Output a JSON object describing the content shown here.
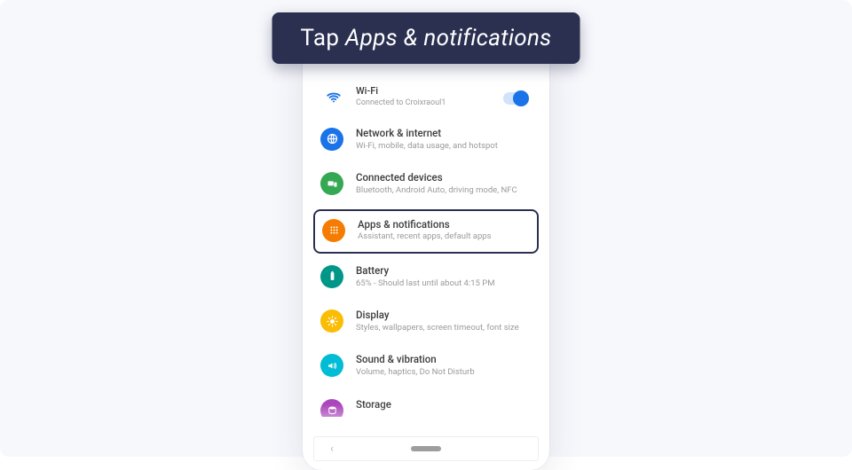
{
  "banner": {
    "prefix": "Tap ",
    "italic": "Apps & notifications"
  },
  "settings": {
    "wifi": {
      "title": "Wi-Fi",
      "subtitle": "Connected to Croixraoul1",
      "icon_color": "#1a73e8"
    },
    "items": [
      {
        "title": "Network & internet",
        "subtitle": "Wi-Fi, mobile, data usage, and hotspot",
        "icon_color": "#1a73e8",
        "icon": "globe",
        "highlighted": false
      },
      {
        "title": "Connected devices",
        "subtitle": "Bluetooth, Android Auto, driving mode, NFC",
        "icon_color": "#34a853",
        "icon": "devices",
        "highlighted": false
      },
      {
        "title": "Apps & notifications",
        "subtitle": "Assistant, recent apps, default apps",
        "icon_color": "#f57c00",
        "icon": "grid",
        "highlighted": true
      },
      {
        "title": "Battery",
        "subtitle": "65% - Should last until about 4:15 PM",
        "icon_color": "#009688",
        "icon": "battery",
        "highlighted": false
      },
      {
        "title": "Display",
        "subtitle": "Styles, wallpapers, screen timeout, font size",
        "icon_color": "#fbbc04",
        "icon": "brightness",
        "highlighted": false
      },
      {
        "title": "Sound & vibration",
        "subtitle": "Volume, haptics, Do Not Disturb",
        "icon_color": "#00bcd4",
        "icon": "sound",
        "highlighted": false
      },
      {
        "title": "Storage",
        "subtitle": "",
        "icon_color": "#ab47bc",
        "icon": "storage",
        "highlighted": false
      }
    ]
  }
}
